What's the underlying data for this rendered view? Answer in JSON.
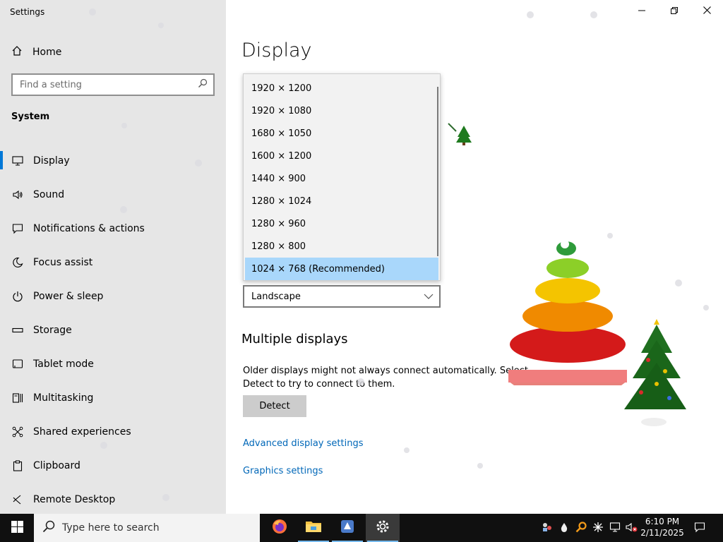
{
  "window": {
    "title": "Settings"
  },
  "sidebar": {
    "home_label": "Home",
    "search_placeholder": "Find a setting",
    "section": "System",
    "items": [
      {
        "label": "Display",
        "icon": "monitor-icon",
        "active": true
      },
      {
        "label": "Sound",
        "icon": "speaker-icon"
      },
      {
        "label": "Notifications & actions",
        "icon": "message-icon"
      },
      {
        "label": "Focus assist",
        "icon": "moon-icon"
      },
      {
        "label": "Power & sleep",
        "icon": "power-icon"
      },
      {
        "label": "Storage",
        "icon": "drive-icon"
      },
      {
        "label": "Tablet mode",
        "icon": "tablet-icon"
      },
      {
        "label": "Multitasking",
        "icon": "multitask-icon"
      },
      {
        "label": "Shared experiences",
        "icon": "share-icon"
      },
      {
        "label": "Clipboard",
        "icon": "clipboard-icon"
      },
      {
        "label": "Remote Desktop",
        "icon": "remote-icon"
      }
    ]
  },
  "main": {
    "title": "Display",
    "resolution_options": [
      "1920 × 1200",
      "1920 × 1080",
      "1680 × 1050",
      "1600 × 1200",
      "1440 × 900",
      "1280 × 1024",
      "1280 × 960",
      "1280 × 800",
      "1024 × 768 (Recommended)"
    ],
    "selected_resolution": "1024 × 768 (Recommended)",
    "orientation": "Landscape",
    "multiple_displays": {
      "heading": "Multiple displays",
      "description": "Older displays might not always connect automatically. Select Detect to try to connect to them.",
      "detect_label": "Detect"
    },
    "links": {
      "advanced": "Advanced display settings",
      "graphics": "Graphics settings"
    }
  },
  "taskbar": {
    "search_placeholder": "Type here to search",
    "apps": [
      "firefox-icon",
      "file-explorer-icon",
      "app-icon",
      "settings-icon"
    ],
    "time": "6:10 PM",
    "date": "2/11/2025"
  },
  "colors": {
    "accent": "#0078d7",
    "link": "#0067b8",
    "selection": "#a9d7fb",
    "sidebar_bg": "#e6e6e6",
    "taskbar_bg": "#101010"
  }
}
